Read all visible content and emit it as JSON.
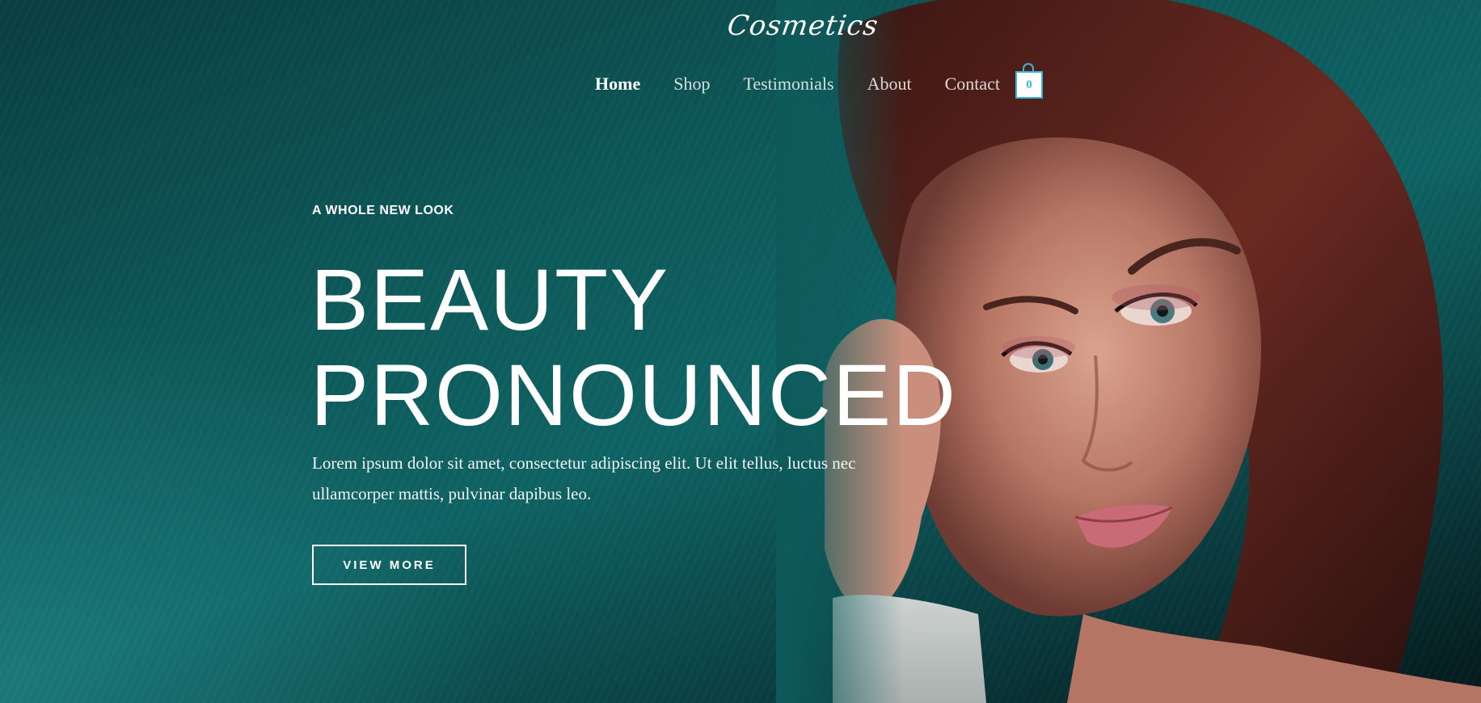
{
  "brand": {
    "logo_text": "Cosmetics"
  },
  "nav": {
    "items": [
      {
        "label": "Home"
      },
      {
        "label": "Shop"
      },
      {
        "label": "Testimonials"
      },
      {
        "label": "About"
      },
      {
        "label": "Contact"
      }
    ]
  },
  "cart": {
    "count": "0",
    "icon": "shopping-bag-icon"
  },
  "hero": {
    "eyebrow": "A WHOLE NEW LOOK",
    "headline_line1": "BEAUTY",
    "headline_line2": "PRONOUNCED",
    "lead": "Lorem ipsum dolor sit amet, consectetur adipiscing elit. Ut elit tellus, luctus nec ullamcorper mattis, pulvinar dapibus leo.",
    "cta_label": "VIEW MORE"
  },
  "colors": {
    "accent": "#3bb4d8",
    "background": "#0d4a4c",
    "text": "#ffffff"
  }
}
